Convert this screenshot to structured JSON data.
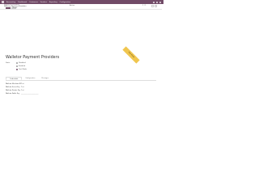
{
  "topbar": {
    "app": "Accounting",
    "menus": [
      "Dashboard",
      "Customers",
      "Vendors",
      "Reporting",
      "Configuration"
    ]
  },
  "breadcrumb": {
    "parent": "Payment Providers",
    "current": "Walletor Payment Providers"
  },
  "actions": {
    "save": "Save",
    "discard": "Discard",
    "action": "Action",
    "pager": "1 / 1"
  },
  "form": {
    "title": "Walletor Payment Providers",
    "state_label": "State",
    "state_options": [
      "Disabled",
      "Enabled",
      "Test Mode"
    ],
    "state_selected": "Test Mode",
    "ribbon": "Test Mode",
    "tabs": [
      "Credentials",
      "Configuration",
      "Messages"
    ],
    "fields": [
      {
        "label": "Walletor Merchant ID",
        "value": "Test"
      },
      {
        "label": "Walletor Secret Key",
        "value": "Test"
      },
      {
        "label": "Walletor Private Key",
        "value": "Test"
      },
      {
        "label": "Walletor Public Key",
        "value": "________________________"
      }
    ]
  },
  "colors": {
    "brand": "#714b67",
    "ribbon": "#f0c64f"
  }
}
